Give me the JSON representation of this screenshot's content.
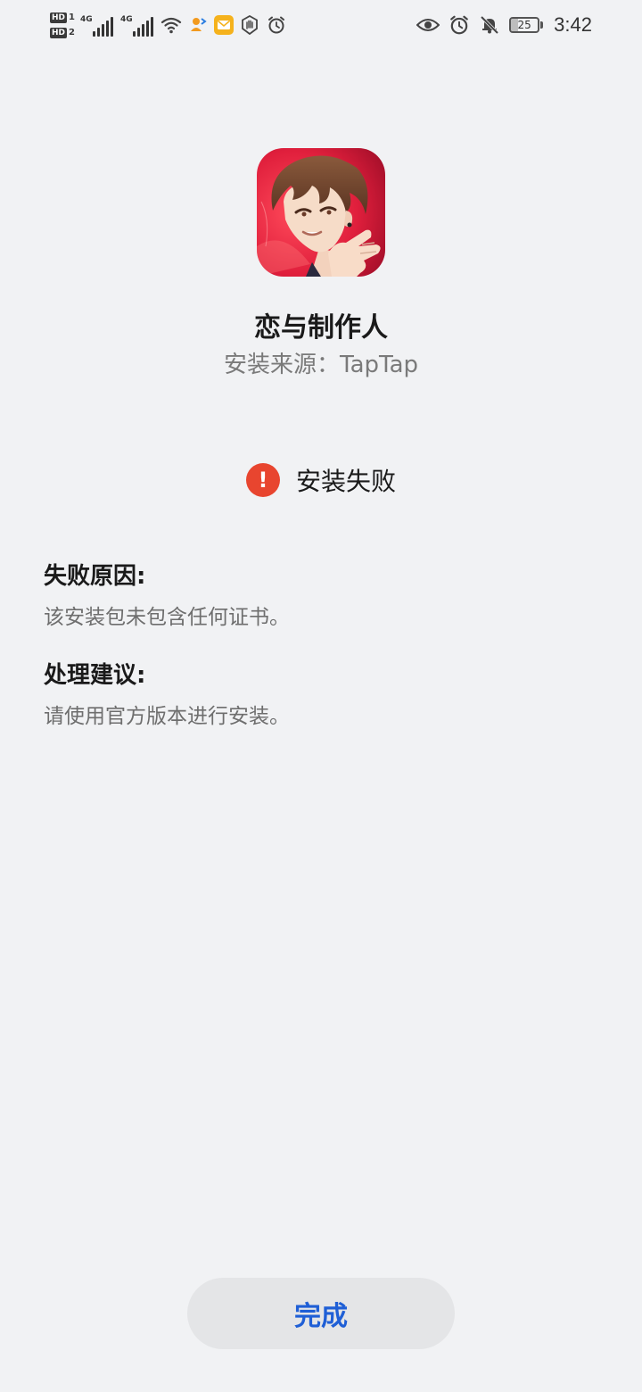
{
  "status_bar": {
    "sim_tags": [
      {
        "label": "HD",
        "num": "1"
      },
      {
        "label": "HD",
        "num": "2"
      }
    ],
    "network_labels": [
      "4G",
      "4G"
    ],
    "battery_level": 25,
    "battery_text": "25",
    "time": "3:42",
    "icons": [
      "hd-sim-icon",
      "signal-4g-icon",
      "signal-4g-icon",
      "wifi-icon",
      "app-notification-icon",
      "mail-notification-icon",
      "hand-icon",
      "alarm-icon",
      "eye-icon",
      "alarm-icon",
      "mute-bell-icon",
      "battery-icon"
    ]
  },
  "app": {
    "name": "恋与制作人",
    "source": "安装来源：TapTap",
    "icon": "app-character-icon"
  },
  "install": {
    "status_text": "安装失败",
    "status_color": "#e8452f"
  },
  "reason": {
    "title": "失败原因:",
    "body": "该安装包未包含任何证书。"
  },
  "suggestion": {
    "title": "处理建议:",
    "body": "请使用官方版本进行安装。"
  },
  "footer": {
    "done_label": "完成",
    "accent_color": "#1f5fd6"
  }
}
